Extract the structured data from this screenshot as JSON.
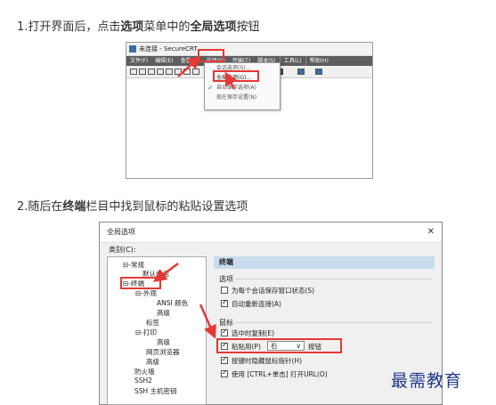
{
  "steps": {
    "step1": {
      "pre": "1.打开界面后，点击",
      "b1": "选项",
      "mid": "菜单中的",
      "b2": "全局选项",
      "post": "按钮"
    },
    "step2": {
      "pre": "2.随后在",
      "b1": "终端",
      "post": "栏目中找到鼠标的粘贴设置选项"
    }
  },
  "screenshot1": {
    "window_title": "未连接 - SecureCRT",
    "menu": [
      "文件(F)",
      "编辑(E)",
      "查看(V)",
      "选项(O)",
      "传输(T)",
      "脚本(S)",
      "工具(L)",
      "帮助(H)"
    ],
    "dropdown": [
      "会话选项(S)...",
      "全局选项(G)...",
      "自动保存选项(A)",
      "现在保存设置(N)"
    ]
  },
  "screenshot2": {
    "dialog_title": "全局选项",
    "close_glyph": "✕",
    "category_label": "类别(C):",
    "tree": [
      {
        "label": "常规",
        "prefix": "⊟-"
      },
      {
        "label": "默认会话",
        "prefix": ""
      },
      {
        "label": "终端",
        "prefix": "⊟-"
      },
      {
        "label": "外观",
        "prefix": "⊟-"
      },
      {
        "label": "ANSI 颜色",
        "prefix": ""
      },
      {
        "label": "高级",
        "prefix": ""
      },
      {
        "label": "标签",
        "prefix": ""
      },
      {
        "label": "打印",
        "prefix": "⊟-"
      },
      {
        "label": "高级",
        "prefix": ""
      },
      {
        "label": "网页浏览器",
        "prefix": ""
      },
      {
        "label": "高级",
        "prefix": ""
      },
      {
        "label": "防火墙",
        "prefix": ""
      },
      {
        "label": "SSH2",
        "prefix": ""
      },
      {
        "label": "SSH 主机密钥",
        "prefix": ""
      }
    ],
    "panel_title": "终端",
    "section_options": "选项",
    "options": [
      {
        "label": "为每个会话保存窗口状态(S)",
        "checked": false
      },
      {
        "label": "自动重新连接(A)",
        "checked": true
      }
    ],
    "section_mouse": "鼠标",
    "mouse_options": {
      "copy_on_select": "选中时复制(E)",
      "paste_with_prefix": "粘贴用(P)",
      "paste_button_value": "右",
      "paste_suffix": "按钮",
      "hide_pointer": "按键时隐藏鼠标指针(H)",
      "ctrl_click": "使用 [CTRL+单击] 打开URL(O)"
    }
  },
  "watermark": "最需教育",
  "colors": {
    "highlight": "#e53935",
    "header_bg": "#c9dcef",
    "menubar_bg": "#5d5d5d",
    "watermark": "#233a8a"
  }
}
